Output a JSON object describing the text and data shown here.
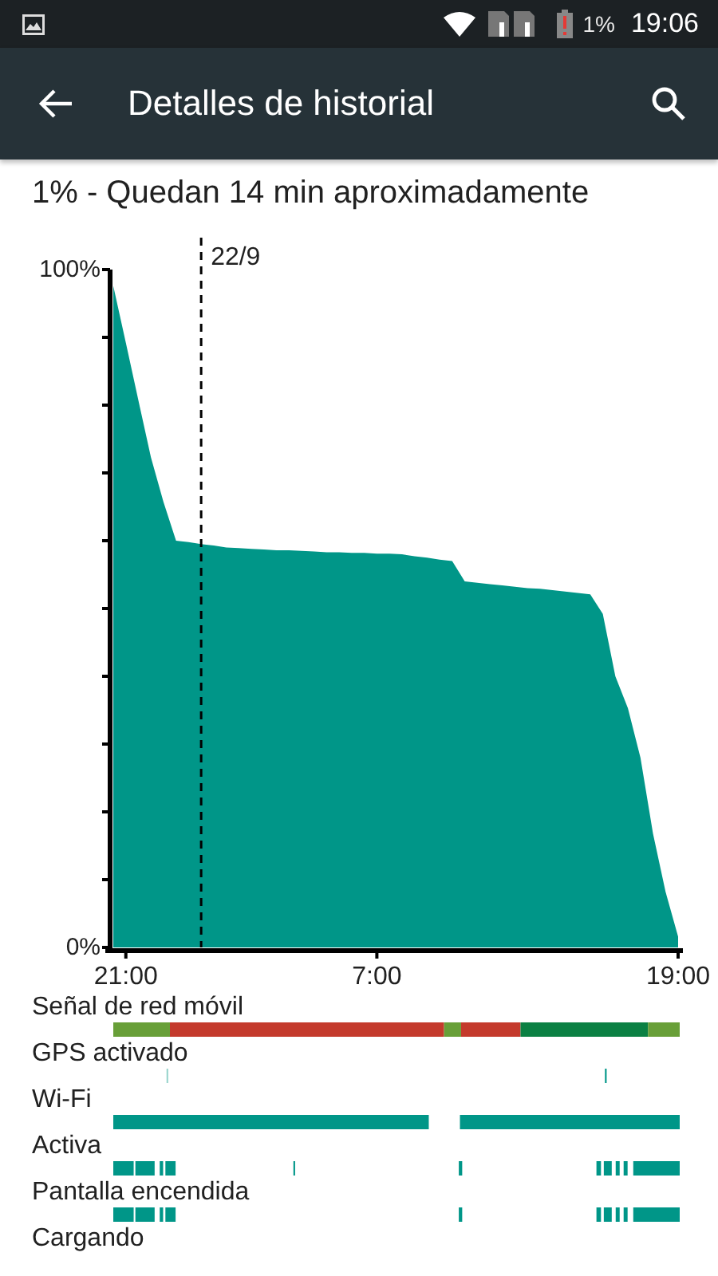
{
  "status_bar": {
    "battery": "1%",
    "time": "19:06"
  },
  "app_bar": {
    "title": "Detalles de historial"
  },
  "summary": "1% - Quedan 14 min aproximadamente",
  "chart_data": {
    "type": "area",
    "ylim": [
      0,
      100
    ],
    "categories": [
      null,
      "21:00",
      null,
      null,
      null,
      null,
      null,
      null,
      null,
      null,
      null,
      null,
      null,
      null,
      null,
      null,
      null,
      null,
      null,
      null,
      null,
      "7:00",
      null,
      null,
      null,
      null,
      null,
      null,
      null,
      null,
      null,
      null,
      null,
      null,
      null,
      null,
      null,
      null,
      null,
      null,
      null,
      null,
      null,
      null,
      null,
      "19:00"
    ],
    "series": [
      {
        "color": "#009688",
        "values": [
          97.6,
          89.2,
          80.7,
          72.3,
          65.7,
          60,
          59.8,
          59.5,
          59.3,
          59,
          58.9,
          58.8,
          58.7,
          58.6,
          58.6,
          58.5,
          58.4,
          58.3,
          58.3,
          58.2,
          58.2,
          58.1,
          58.1,
          58,
          57.7,
          57.5,
          57.2,
          57,
          54,
          53.8,
          53.6,
          53.4,
          53.2,
          53,
          52.9,
          52.7,
          52.5,
          52.3,
          52.1,
          49.2,
          40,
          35.3,
          28,
          16.8,
          8.2,
          1.6
        ]
      }
    ],
    "yticks": [
      {
        "value": 0,
        "label": "0%"
      },
      {
        "value": 100,
        "label": "100%"
      }
    ],
    "annotations": [
      "22/9"
    ]
  },
  "tracks": [
    {
      "label": "Señal de red móvil",
      "kind": "signal"
    },
    {
      "label": "GPS activado",
      "kind": "gps"
    },
    {
      "label": "Wi-Fi",
      "kind": "wifi"
    },
    {
      "label": "Activa",
      "kind": "awake"
    },
    {
      "label": "Pantalla encendida",
      "kind": "screen"
    },
    {
      "label": "Cargando",
      "kind": "charging"
    }
  ]
}
